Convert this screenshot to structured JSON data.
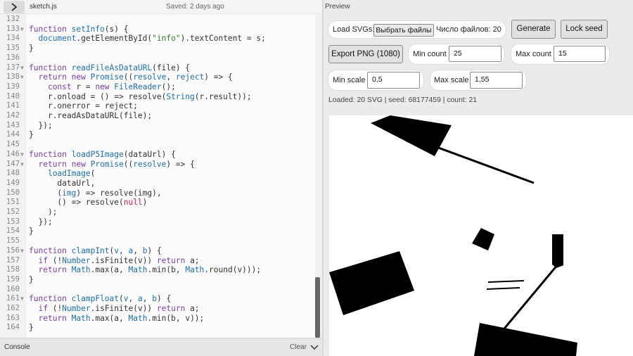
{
  "editor": {
    "file_name": "sketch.js",
    "saved_status": "Saved: 2 days ago",
    "lines": [
      {
        "n": "132",
        "fold": "",
        "html": ""
      },
      {
        "n": "133",
        "fold": "▼",
        "html": "<span class='tok-kw'>function</span> <span class='tok-fn'>setInfo</span>(s) {"
      },
      {
        "n": "134",
        "fold": "",
        "html": "  <span class='tok-fn'>document</span>.getElementById(<span class='tok-str'>\"info\"</span>).textContent = s;"
      },
      {
        "n": "135",
        "fold": "",
        "html": "}"
      },
      {
        "n": "136",
        "fold": "",
        "html": ""
      },
      {
        "n": "137",
        "fold": "▼",
        "html": "<span class='tok-kw'>function</span> <span class='tok-fn'>readFileAsDataURL</span>(file) {"
      },
      {
        "n": "138",
        "fold": "▼",
        "html": "  <span class='tok-kw'>return new</span> <span class='tok-fn'>Promise</span>((<span class='tok-fn'>resolve</span>, <span class='tok-fn'>reject</span>) => {"
      },
      {
        "n": "139",
        "fold": "",
        "html": "    <span class='tok-kw'>const</span> r = <span class='tok-kw'>new</span> <span class='tok-fn'>FileReader</span>();"
      },
      {
        "n": "140",
        "fold": "",
        "html": "    r.onload = () => resolve(<span class='tok-fn'>String</span>(r.result));"
      },
      {
        "n": "141",
        "fold": "",
        "html": "    r.onerror = reject;"
      },
      {
        "n": "142",
        "fold": "",
        "html": "    r.readAsDataURL(file);"
      },
      {
        "n": "143",
        "fold": "",
        "html": "  });"
      },
      {
        "n": "144",
        "fold": "",
        "html": "}"
      },
      {
        "n": "145",
        "fold": "",
        "html": ""
      },
      {
        "n": "146",
        "fold": "▼",
        "html": "<span class='tok-kw'>function</span> <span class='tok-fn'>loadP5Image</span>(dataUrl) {"
      },
      {
        "n": "147",
        "fold": "▼",
        "html": "  <span class='tok-kw'>return new</span> <span class='tok-fn'>Promise</span>((<span class='tok-fn'>resolve</span>) => {"
      },
      {
        "n": "148",
        "fold": "",
        "html": "    <span class='tok-fn'>loadImage</span>("
      },
      {
        "n": "149",
        "fold": "",
        "html": "      dataUrl,"
      },
      {
        "n": "150",
        "fold": "",
        "html": "      (<span class='tok-fn'>img</span>) => resolve(img),"
      },
      {
        "n": "151",
        "fold": "",
        "html": "      () => resolve(<span class='tok-null'>null</span>)"
      },
      {
        "n": "152",
        "fold": "",
        "html": "    );"
      },
      {
        "n": "153",
        "fold": "",
        "html": "  });"
      },
      {
        "n": "154",
        "fold": "",
        "html": "}"
      },
      {
        "n": "155",
        "fold": "",
        "html": ""
      },
      {
        "n": "156",
        "fold": "▼",
        "html": "<span class='tok-kw'>function</span> <span class='tok-fn'>clampInt</span>(<span class='tok-fn'>v</span>, <span class='tok-fn'>a</span>, <span class='tok-fn'>b</span>) {"
      },
      {
        "n": "157",
        "fold": "",
        "html": "  <span class='tok-kw'>if</span> (!<span class='tok-fn'>Number</span>.isFinite(v)) <span class='tok-kw'>return</span> a;"
      },
      {
        "n": "158",
        "fold": "",
        "html": "  <span class='tok-kw'>return</span> <span class='tok-fn'>Math</span>.max(a, <span class='tok-fn'>Math</span>.min(b, <span class='tok-fn'>Math</span>.round(v)));"
      },
      {
        "n": "159",
        "fold": "",
        "html": "}"
      },
      {
        "n": "160",
        "fold": "",
        "html": ""
      },
      {
        "n": "161",
        "fold": "▼",
        "html": "<span class='tok-kw'>function</span> <span class='tok-fn'>clampFloat</span>(<span class='tok-fn'>v</span>, <span class='tok-fn'>a</span>, <span class='tok-fn'>b</span>) {"
      },
      {
        "n": "162",
        "fold": "",
        "html": "  <span class='tok-kw'>if</span> (!<span class='tok-fn'>Number</span>.isFinite(v)) <span class='tok-kw'>return</span> a;"
      },
      {
        "n": "163",
        "fold": "",
        "html": "  <span class='tok-kw'>return</span> <span class='tok-fn'>Math</span>.max(a, <span class='tok-fn'>Math</span>.min(b, v));"
      },
      {
        "n": "164",
        "fold": "",
        "html": "}"
      }
    ]
  },
  "console": {
    "label": "Console",
    "clear_label": "Clear"
  },
  "preview": {
    "title": "Preview",
    "load_label": "Load SVGs:",
    "file_button": "Выбрать файлы",
    "file_count": "Число файлов: 20",
    "generate_label": "Generate",
    "lock_seed_label": "Lock seed",
    "export_label": "Export PNG (1080)",
    "min_count_label": "Min count",
    "min_count_value": "25",
    "max_count_label": "Max count",
    "max_count_value": "15",
    "min_scale_label": "Min scale",
    "min_scale_value": "0,5",
    "max_scale_label": "Max scale",
    "max_scale_value": "1,55",
    "status": "Loaded: 20 SVG | seed: 68177459 | count: 21"
  },
  "colors": {
    "shape_fill": "#000000",
    "canvas_bg": "#ffffff"
  }
}
